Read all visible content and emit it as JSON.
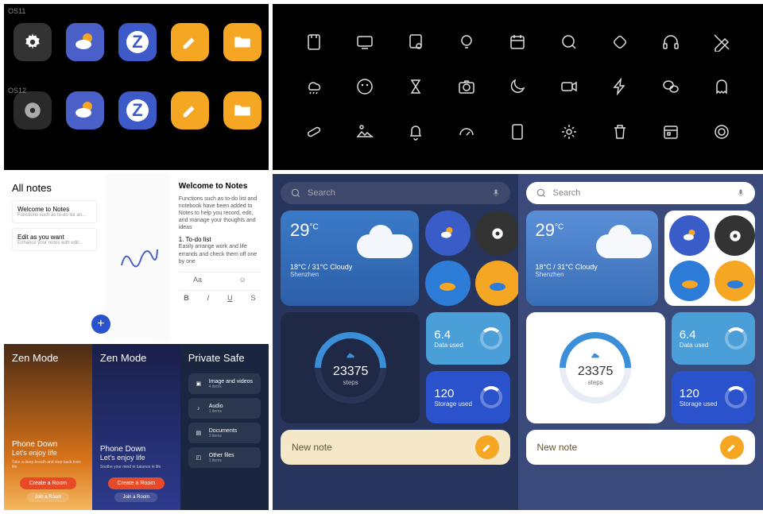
{
  "os_labels": {
    "v1": "OS11",
    "v2": "OS12"
  },
  "notes": {
    "title": "All notes",
    "card1": {
      "t": "Welcome to Notes",
      "s": "Functions such as to-do list an..."
    },
    "card2": {
      "t": "Edit as you want",
      "s": "Enhance your notes with edit..."
    },
    "welcome": {
      "t": "Welcome to Notes",
      "body": "Functions such as to-do list and notebook have been added to Notes to help you record, edit, and manage your thoughts and ideas",
      "todo_h": "1. To-do list",
      "todo_b": "Easily arrange work and life errands and check them off one by one"
    }
  },
  "zen": {
    "title": "Zen Mode",
    "h": "Phone Down",
    "sub": "Let's enjoy life",
    "small1": "Take a deep breath and step back from life",
    "small2": "Soothe your mind in balance in life",
    "create": "Create a Room",
    "join": "Join a Room"
  },
  "safe": {
    "title": "Private Safe",
    "items": [
      "Image and videos",
      "Audio",
      "Documents",
      "Other files"
    ],
    "counts": [
      "4 items",
      "1 items",
      "3 items",
      "1 items"
    ]
  },
  "dash": {
    "search": "Search",
    "temp": "29",
    "unit": "°C",
    "range": "18°C / 31°C  Cloudy",
    "loc": "Shenzhen",
    "steps": "23375",
    "steps_l": "steps",
    "data": {
      "n": "6.4",
      "l": "Data used"
    },
    "storage": {
      "n": "120",
      "l": "Storage used"
    },
    "note": "New note"
  },
  "toolbar": {
    "b": "B",
    "i": "I",
    "u": "U",
    "s": "S",
    "aa": "Aa"
  }
}
